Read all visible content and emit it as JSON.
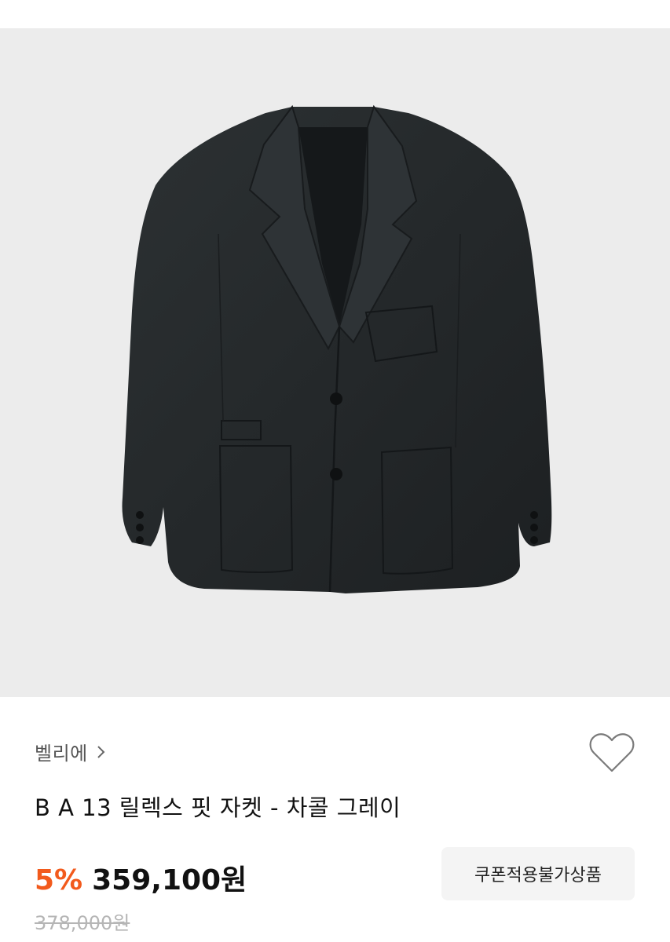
{
  "product": {
    "brand": "벨리에",
    "title": "B A 13 릴렉스 핏 자켓 - 차콜 그레이",
    "discount": "5%",
    "price": "359,100원",
    "original_price": "378,000원",
    "coupon_label": "쿠폰적용불가상품"
  },
  "colors": {
    "image_background": "#ececec",
    "jacket": "#24282a",
    "discount_accent": "#f25a1c"
  },
  "icons": {
    "brand_chevron": "chevron-right-icon",
    "wishlist": "heart-outline-icon"
  }
}
